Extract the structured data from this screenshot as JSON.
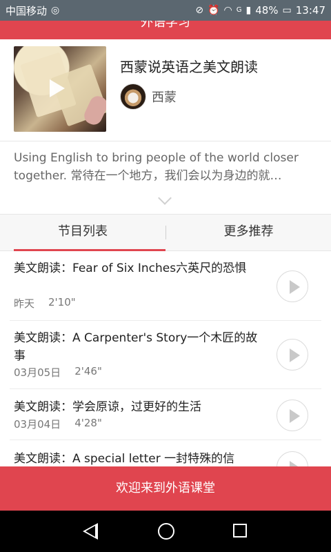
{
  "status_bar": {
    "carrier": "中国移动",
    "battery": "48%",
    "network": "G",
    "time": "13:47",
    "icons": [
      "hotspot-icon",
      "mute-icon",
      "alarm-icon",
      "wifi-icon",
      "signal-icon",
      "battery-icon"
    ]
  },
  "header": {
    "title": "外语学习"
  },
  "program": {
    "title": "西蒙说英语之美文朗读",
    "author": "西蒙"
  },
  "description": {
    "line1": "Using English to bring people of the world closer",
    "line2": "together. 常待在一个地方，我们会以为身边的就…"
  },
  "tabs": [
    {
      "label": "节目列表",
      "active": true
    },
    {
      "label": "更多推荐",
      "active": false
    }
  ],
  "episodes": [
    {
      "title": "美文朗读：Fear of Six Inches六英尺的恐惧",
      "date": "昨天",
      "duration": "2'10\""
    },
    {
      "title": "美文朗读：A Carpenter's Story一个木匠的故事",
      "date": "03月05日",
      "duration": "2'46\""
    },
    {
      "title": "美文朗读：学会原谅，过更好的生活",
      "date": "03月04日",
      "duration": "4'28\""
    },
    {
      "title": "美文朗读：A special letter 一封特殊的信",
      "date": "",
      "duration": ""
    }
  ],
  "bottom_banner": "欢迎来到外语课堂",
  "colors": {
    "accent": "#e0454f",
    "status_bar": "#5b6770"
  }
}
